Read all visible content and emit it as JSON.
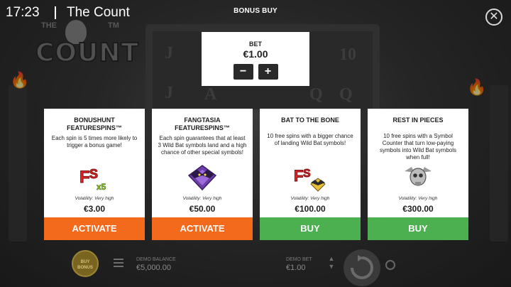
{
  "header": {
    "time": "17:23",
    "game_title": "The Count",
    "dialog_title": "BONUS BUY",
    "close_icon": "close-icon"
  },
  "logo": {
    "small_left": "THE",
    "small_right": "TM",
    "word": "COUNT"
  },
  "bet": {
    "label": "BET",
    "value": "€1.00",
    "minus_label": "−",
    "plus_label": "+"
  },
  "cards": [
    {
      "title": "BONUSHUNT FEATURESPINS™",
      "description": "Each spin is 5 times more likely to trigger a bonus game!",
      "icon": "fs-x5-icon",
      "volatility": "Volatility: Very high",
      "price": "€3.00",
      "button": "ACTIVATE",
      "button_color": "#f46a1c"
    },
    {
      "title": "FANGTASIA FEATURESPINS™",
      "description": "Each spin guarantees that at least 3 Wild Bat symbols land and a high chance of other special symbols!",
      "icon": "purple-bat-icon",
      "volatility": "Volatility: Very high",
      "price": "€50.00",
      "button": "ACTIVATE",
      "button_color": "#f46a1c"
    },
    {
      "title": "BAT TO THE BONE",
      "description": "10 free spins with a bigger chance of landing Wild Bat symbols!",
      "icon": "fs-bat-icon",
      "volatility": "Volatility: Very high",
      "price": "€100.00",
      "button": "BUY",
      "button_color": "#4caf50"
    },
    {
      "title": "REST IN PIECES",
      "description": "10 free spins with a Symbol Counter that turn low-paying symbols into Wild Bat symbols when full!",
      "icon": "skull-bat-icon",
      "volatility": "Volatility: Very high",
      "price": "€300.00",
      "button": "BUY",
      "button_color": "#4caf50"
    }
  ],
  "footer": {
    "buy_bonus_label": "BUY BONUS",
    "balance_label": "DEMO BALANCE",
    "balance_value": "€5,000.00",
    "bet_label": "DEMO BET",
    "bet_value": "€1.00"
  },
  "background": {
    "reel_glyphs": [
      "J",
      "10",
      "J",
      "A",
      "Q",
      "Q"
    ]
  }
}
